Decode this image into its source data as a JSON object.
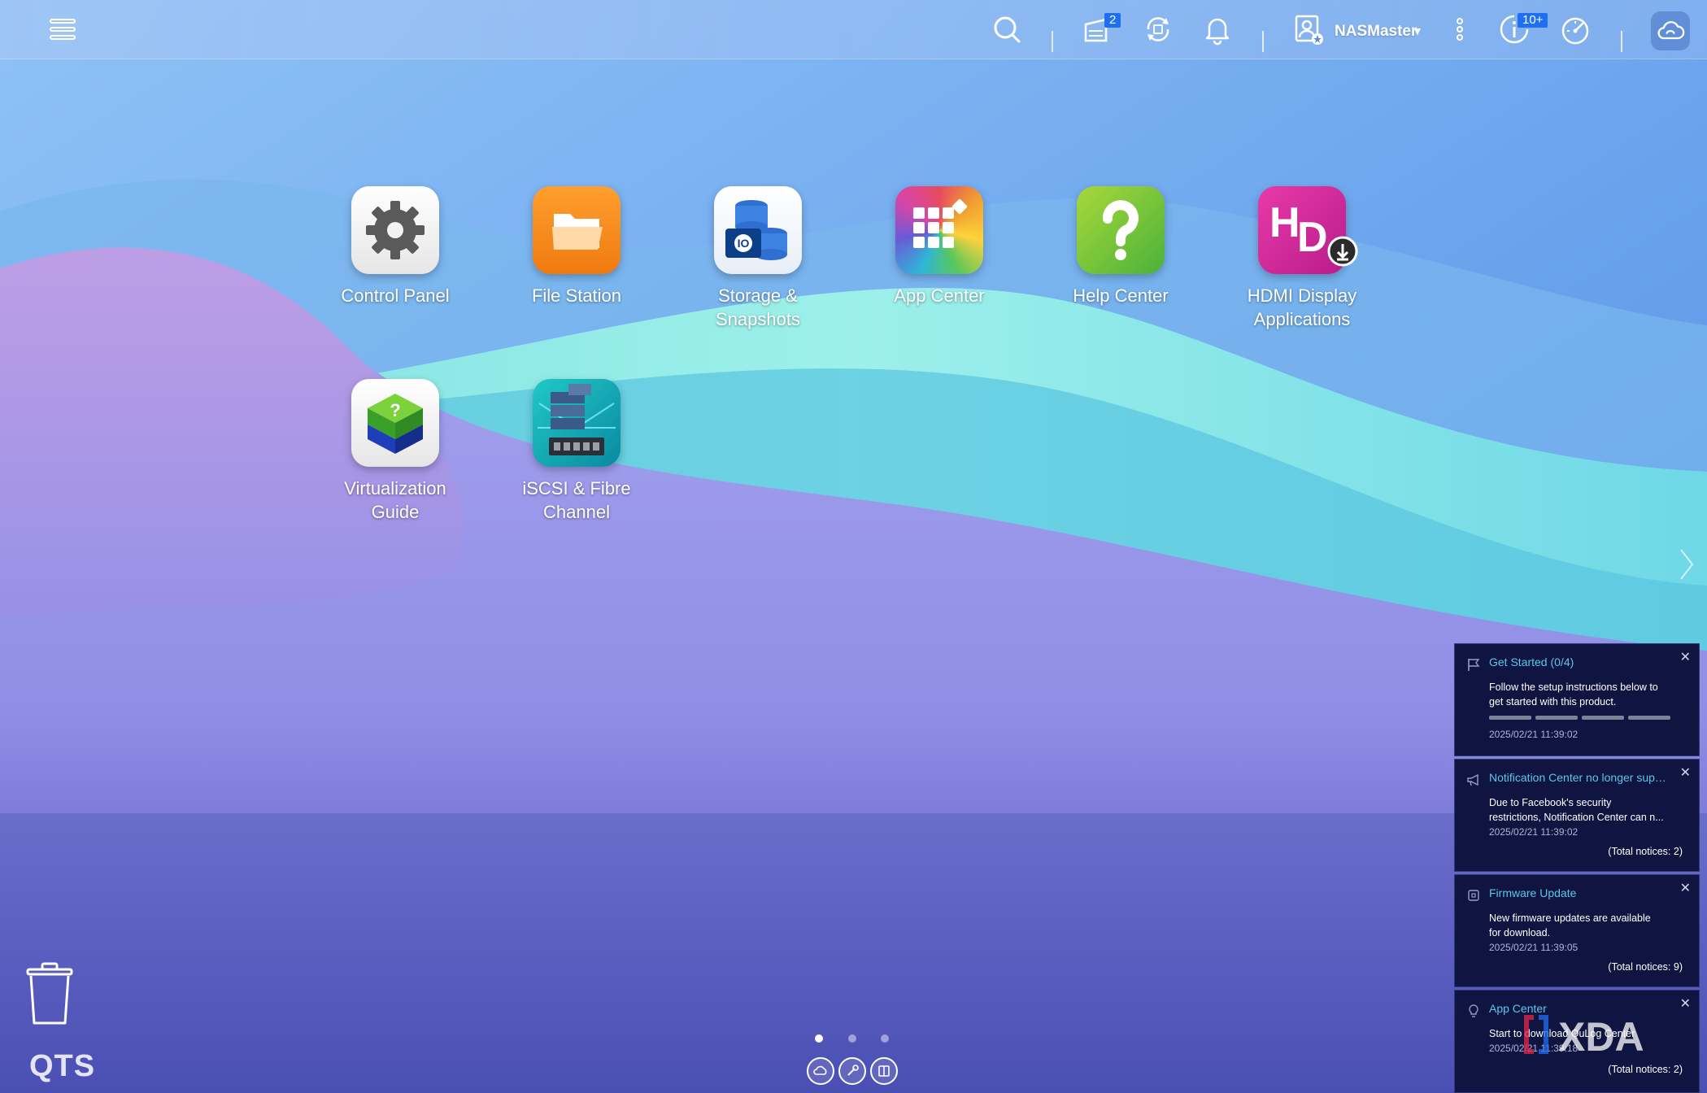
{
  "topbar": {
    "user_name": "NASMaster",
    "background_tasks_badge": "2",
    "system_status_badge": "10+"
  },
  "apps": [
    {
      "label": "Control Panel",
      "icon": "gear-icon"
    },
    {
      "label": "File Station",
      "icon": "folder-icon"
    },
    {
      "label": "Storage &\nSnapshots",
      "icon": "storage-icon"
    },
    {
      "label": "App Center",
      "icon": "app-grid-icon"
    },
    {
      "label": "Help Center",
      "icon": "question-icon"
    },
    {
      "label": "HDMI Display\nApplications",
      "icon": "hd-icon"
    },
    {
      "label": "Virtualization\nGuide",
      "icon": "cube-icon"
    },
    {
      "label": "iSCSI & Fibre\nChannel",
      "icon": "server-icon"
    }
  ],
  "desktop": {
    "logo_text": "QTS",
    "active_page": 1,
    "page_count": 3
  },
  "notifications": [
    {
      "title": "Get Started (0/4)",
      "body": [
        "Follow the setup instructions below to",
        "get started with this product."
      ],
      "progress": 0,
      "timestamp": "2025/02/21 11:39:02",
      "total": ""
    },
    {
      "title": "Notification Center no longer supp...",
      "body": [
        "Due to Facebook's security",
        "restrictions, Notification Center can n..."
      ],
      "timestamp": "2025/02/21 11:39:02",
      "total": "(Total notices: 2)"
    },
    {
      "title": "Firmware Update",
      "body": [
        "New firmware updates are available",
        "for download."
      ],
      "timestamp": "2025/02/21 11:39:05",
      "total": "(Total notices: 9)"
    },
    {
      "title": "App Center",
      "body": [
        "Start to download QuLog Center"
      ],
      "timestamp": "2025/02/21 11:39:18",
      "total": "(Total notices: 2)"
    }
  ],
  "watermark": "XDA",
  "colors": {
    "accent": "#1f6ff2",
    "notif_bg": "#0f1540",
    "notif_title": "#5cc6ea"
  }
}
